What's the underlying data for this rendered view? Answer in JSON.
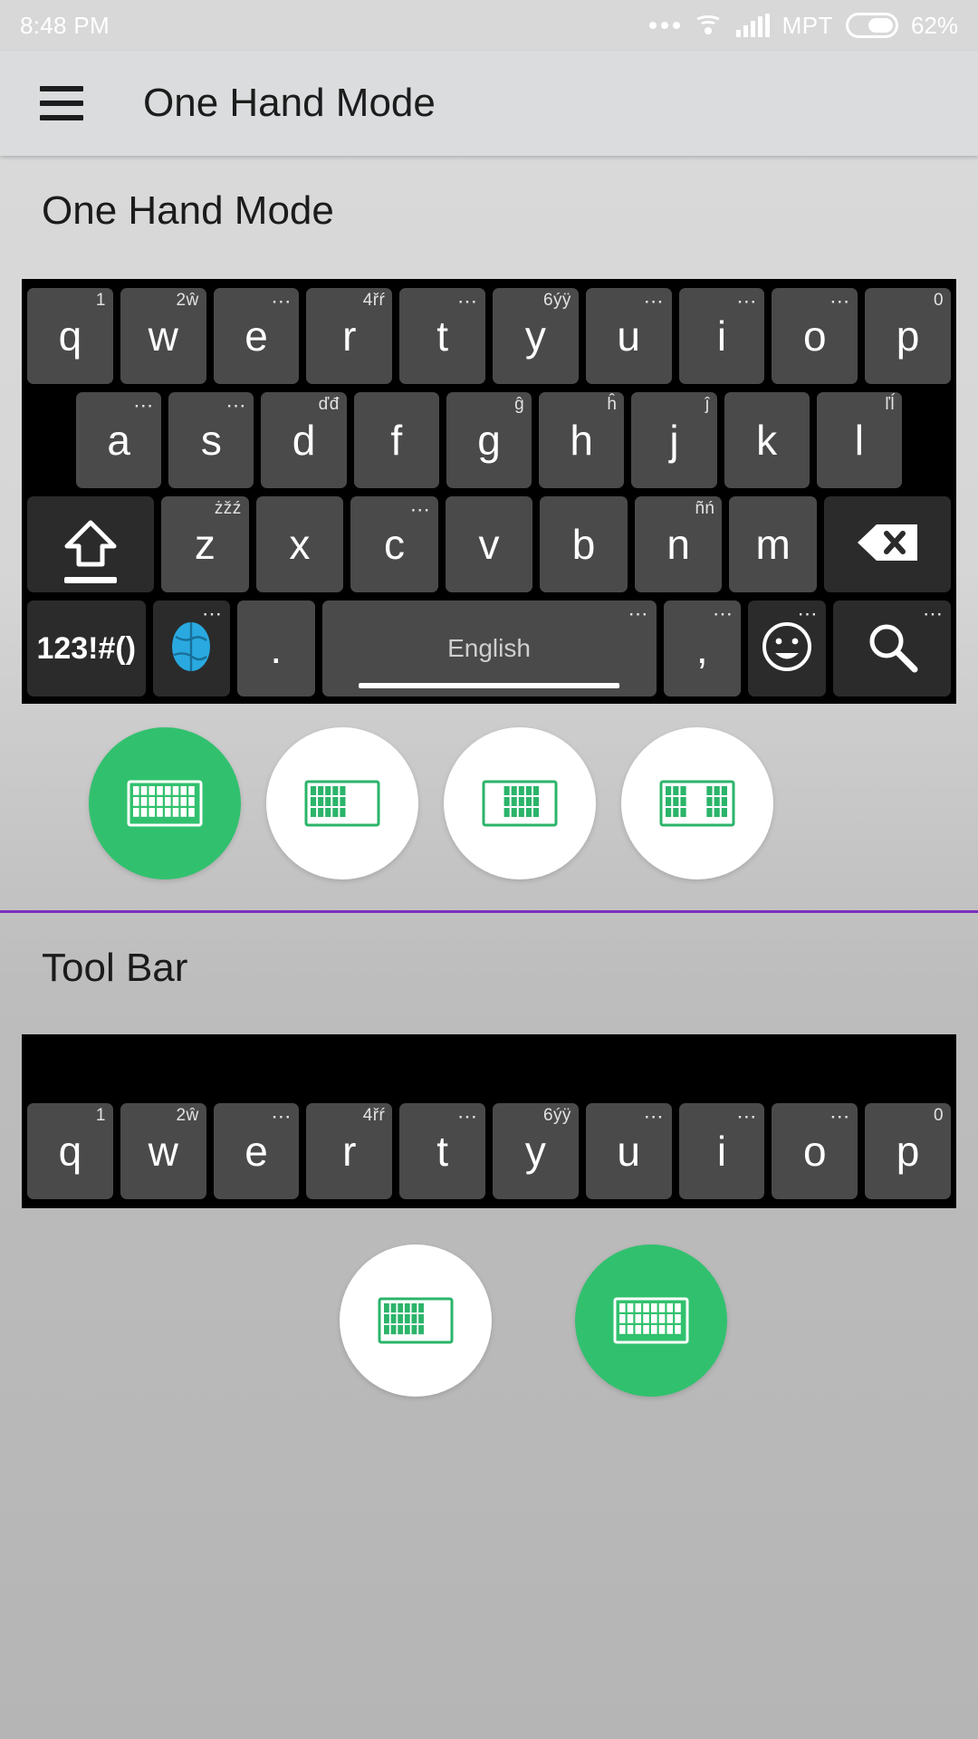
{
  "status_bar": {
    "time": "8:48 PM",
    "carrier": "MPT",
    "battery_pct": "62%",
    "icons": [
      "more-dots-icon",
      "wifi-icon",
      "signal-icon",
      "battery-icon"
    ]
  },
  "app_bar": {
    "menu_icon": "hamburger-menu-icon",
    "title": "One Hand Mode"
  },
  "sections": {
    "one_hand_mode": {
      "title": "One Hand Mode"
    },
    "tool_bar": {
      "title": "Tool Bar"
    }
  },
  "keyboard": {
    "rows": [
      [
        {
          "label": "q",
          "hint": "1"
        },
        {
          "label": "w",
          "hint": "2ŵ"
        },
        {
          "label": "e",
          "hint": "⋯"
        },
        {
          "label": "r",
          "hint": "4řŕ"
        },
        {
          "label": "t",
          "hint": "⋯"
        },
        {
          "label": "y",
          "hint": "6ýÿ"
        },
        {
          "label": "u",
          "hint": "⋯"
        },
        {
          "label": "i",
          "hint": "⋯"
        },
        {
          "label": "o",
          "hint": "⋯"
        },
        {
          "label": "p",
          "hint": "0"
        }
      ],
      [
        {
          "label": "a",
          "hint": "⋯"
        },
        {
          "label": "s",
          "hint": "⋯"
        },
        {
          "label": "d",
          "hint": "ďđ"
        },
        {
          "label": "f",
          "hint": ""
        },
        {
          "label": "g",
          "hint": "ĝ"
        },
        {
          "label": "h",
          "hint": "ĥ"
        },
        {
          "label": "j",
          "hint": "ĵ"
        },
        {
          "label": "k",
          "hint": ""
        },
        {
          "label": "l",
          "hint": "ľĺ"
        }
      ],
      [
        {
          "label": "z",
          "hint": "żžź"
        },
        {
          "label": "x",
          "hint": ""
        },
        {
          "label": "c",
          "hint": "⋯"
        },
        {
          "label": "v",
          "hint": ""
        },
        {
          "label": "b",
          "hint": ""
        },
        {
          "label": "n",
          "hint": "ñń"
        },
        {
          "label": "m",
          "hint": ""
        }
      ]
    ],
    "shift_key": {
      "name": "shift-key",
      "hint": ""
    },
    "backspace_key": {
      "name": "backspace-key",
      "hint": ""
    },
    "bottom_row": {
      "symbols_key": {
        "label": "123!#()",
        "hint": ""
      },
      "globe_key": {
        "label": "",
        "hint": "⋯"
      },
      "period_key": {
        "label": ".",
        "hint": ""
      },
      "space_key": {
        "label": "English",
        "hint": "⋯"
      },
      "comma_key": {
        "label": ",",
        "hint": "⋯"
      },
      "emoji_key": {
        "label": "",
        "hint": "⋯"
      },
      "search_key": {
        "label": "",
        "hint": "⋯"
      }
    }
  },
  "toolbar_keyboard": {
    "row": [
      {
        "label": "q",
        "hint": "1"
      },
      {
        "label": "w",
        "hint": "2ŵ"
      },
      {
        "label": "e",
        "hint": "⋯"
      },
      {
        "label": "r",
        "hint": "4řŕ"
      },
      {
        "label": "t",
        "hint": "⋯"
      },
      {
        "label": "y",
        "hint": "6ýÿ"
      },
      {
        "label": "u",
        "hint": "⋯"
      },
      {
        "label": "i",
        "hint": "⋯"
      },
      {
        "label": "o",
        "hint": "⋯"
      },
      {
        "label": "p",
        "hint": "0"
      }
    ]
  },
  "one_hand_modes": [
    {
      "name": "full-keyboard",
      "icon": "keyboard-full-icon",
      "selected": true
    },
    {
      "name": "left-hand",
      "icon": "keyboard-left-icon",
      "selected": false
    },
    {
      "name": "center-hand",
      "icon": "keyboard-center-icon",
      "selected": false
    },
    {
      "name": "right-hand",
      "icon": "keyboard-split-icon",
      "selected": false
    }
  ],
  "tool_bar_modes": [
    {
      "name": "toolbar-off",
      "icon": "keyboard-small-icon",
      "selected": false
    },
    {
      "name": "toolbar-on",
      "icon": "keyboard-full-icon",
      "selected": true
    }
  ],
  "colors": {
    "accent_green": "#31c16e",
    "divider_purple": "#7b2fbe",
    "key_bg": "#4a4a4a",
    "key_dark_bg": "#2b2b2b",
    "keyboard_bg": "#000000",
    "globe_blue": "#29a9e0"
  }
}
